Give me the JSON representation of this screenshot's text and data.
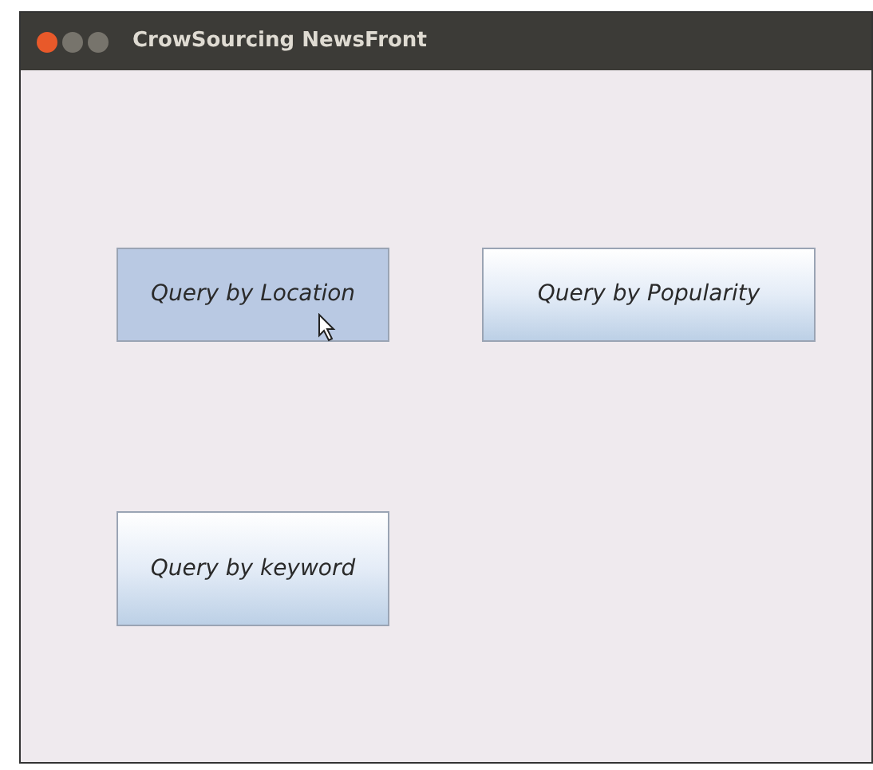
{
  "window": {
    "title": "CrowSourcing NewsFront"
  },
  "buttons": [
    {
      "label": "Query by Location",
      "pressed": true
    },
    {
      "label": "Query by Popularity",
      "pressed": false
    },
    {
      "label": "Query by keyword",
      "pressed": false
    }
  ]
}
